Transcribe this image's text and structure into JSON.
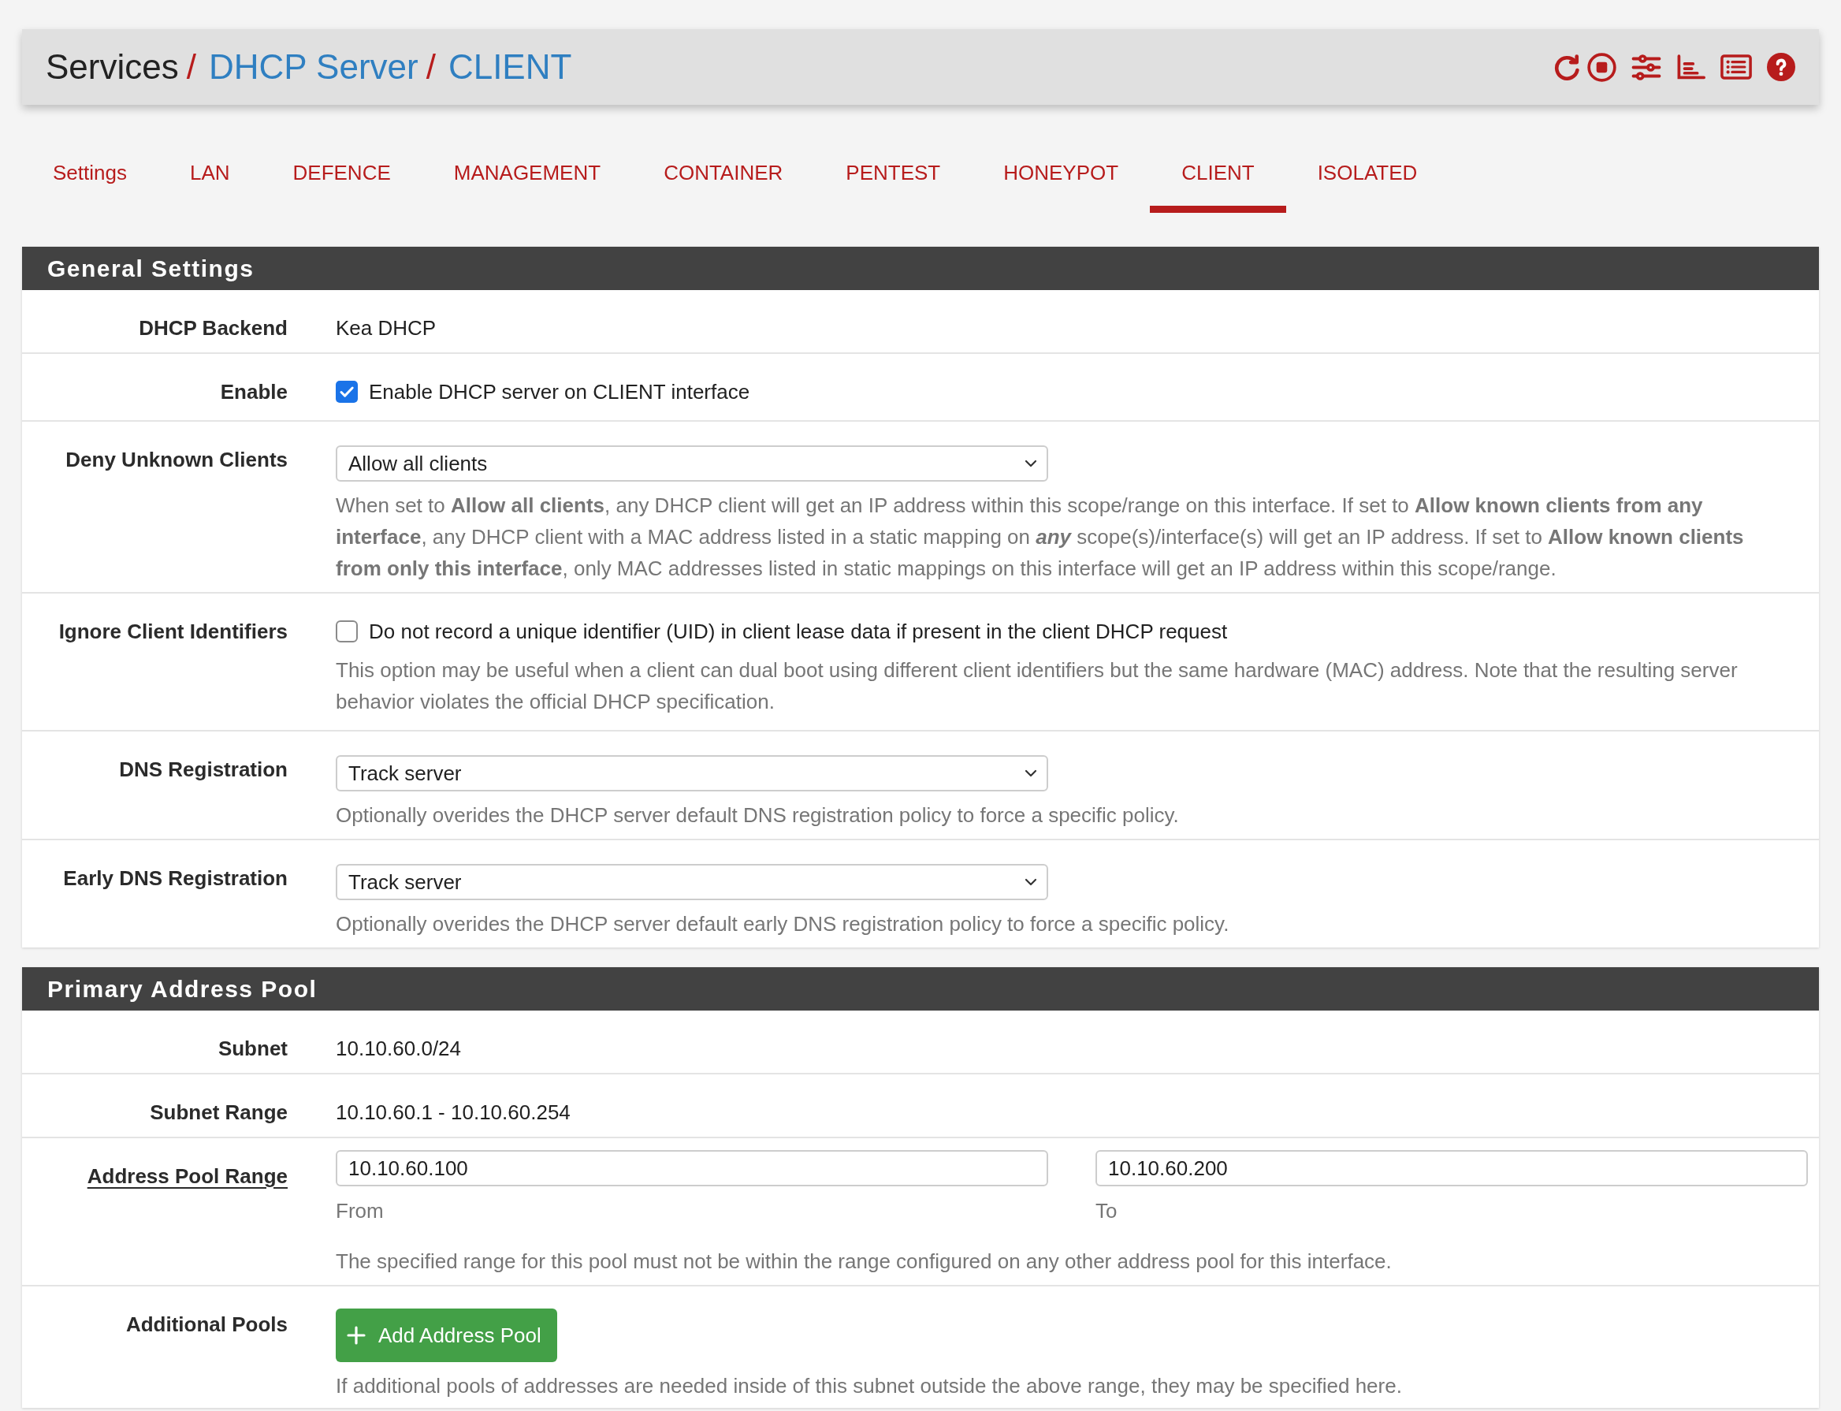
{
  "breadcrumb": [
    {
      "text": "Services",
      "kind": "plain",
      "separator": "/"
    },
    {
      "text": "DHCP Server",
      "kind": "link",
      "separator": "/"
    },
    {
      "text": "CLIENT",
      "kind": "link"
    }
  ],
  "tabs": [
    {
      "label": "Settings",
      "selected": false
    },
    {
      "label": "LAN",
      "selected": false
    },
    {
      "label": "DEFENCE",
      "selected": false
    },
    {
      "label": "MANAGEMENT",
      "selected": false
    },
    {
      "label": "CONTAINER",
      "selected": false
    },
    {
      "label": "PENTEST",
      "selected": false
    },
    {
      "label": "HONEYPOT",
      "selected": false
    },
    {
      "label": "CLIENT",
      "selected": true
    },
    {
      "label": "ISOLATED",
      "selected": false
    }
  ],
  "panels": [
    {
      "title": "General Settings",
      "rows": [
        {
          "kind": "text",
          "label": "DHCP Backend",
          "label_underlined": false,
          "value": "Kea DHCP"
        },
        {
          "kind": "checkbox",
          "label": "Enable",
          "label_underlined": false,
          "checked": true,
          "text": "Enable DHCP server on CLIENT interface"
        },
        {
          "kind": "select",
          "label": "Deny Unknown Clients",
          "label_underlined": false,
          "value": "Allow all clients",
          "help": "When set to **Allow all clients**, any DHCP client will get an IP address within this scope/range on this interface. If set to **Allow known clients from any interface**, any DHCP client with a MAC address listed in a static mapping on *any* scope(s)/interface(s) will get an IP address. If set to **Allow known clients from only this interface**, only MAC addresses listed in static mappings on this interface will get an IP address within this scope/range."
        },
        {
          "kind": "checkbox",
          "label": "Ignore Client Identifiers",
          "label_underlined": false,
          "checked": false,
          "text": "Do not record a unique identifier (UID) in client lease data if present in the client DHCP request",
          "help": "This option may be useful when a client can dual boot using different client identifiers but the same hardware (MAC) address. Note that the resulting server behavior violates the official DHCP specification."
        },
        {
          "kind": "select",
          "label": "DNS Registration",
          "label_underlined": false,
          "value": "Track server",
          "help": "Optionally overides the DHCP server default DNS registration policy to force a specific policy."
        },
        {
          "kind": "select",
          "label": "Early DNS Registration",
          "label_underlined": false,
          "value": "Track server",
          "help": "Optionally overides the DHCP server default early DNS registration policy to force a specific policy."
        }
      ]
    },
    {
      "title": "Primary Address Pool",
      "rows": [
        {
          "kind": "text",
          "label": "Subnet",
          "label_underlined": false,
          "value": "10.10.60.0/24"
        },
        {
          "kind": "text",
          "label": "Subnet Range",
          "label_underlined": false,
          "value": "10.10.60.1 - 10.10.60.254"
        },
        {
          "kind": "range",
          "label": "Address Pool Range",
          "label_underlined": true,
          "fields": [
            {
              "value": "10.10.60.100",
              "caption": "From"
            },
            {
              "value": "10.10.60.200",
              "caption": "To"
            }
          ],
          "help": "The specified range for this pool must not be within the range configured on any other address pool for this interface."
        },
        {
          "kind": "button",
          "label": "Additional Pools",
          "label_underlined": false,
          "button": "Add Address Pool",
          "help": "If additional pools of addresses are needed inside of this subnet outside the above range, they may be specified here."
        }
      ]
    }
  ]
}
